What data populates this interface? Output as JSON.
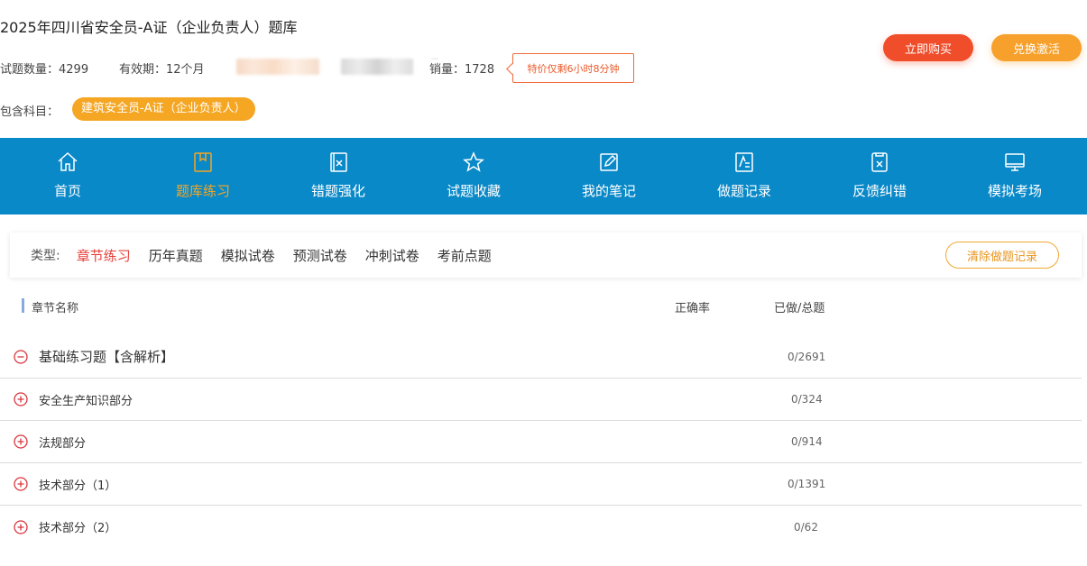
{
  "header": {
    "title": "2025年四川省安全员-A证（企业负责人）题库",
    "question_count": "试题数量：4299",
    "validity": "有效期：12个月",
    "sales": "销量：1728",
    "promo": "特价仅剩6小时8分钟",
    "subject_label": "包含科目：",
    "subject": "建筑安全员-A证（企业负责人）",
    "buy_label": "立即购买",
    "redeem_label": "兑换激活"
  },
  "nav": {
    "items": [
      {
        "label": "首页",
        "icon": "home-icon"
      },
      {
        "label": "题库练习",
        "icon": "book-icon"
      },
      {
        "label": "错题强化",
        "icon": "wrong-doc-icon"
      },
      {
        "label": "试题收藏",
        "icon": "star-icon"
      },
      {
        "label": "我的笔记",
        "icon": "edit-icon"
      },
      {
        "label": "做题记录",
        "icon": "record-icon"
      },
      {
        "label": "反馈纠错",
        "icon": "feedback-icon"
      },
      {
        "label": "模拟考场",
        "icon": "monitor-icon"
      }
    ],
    "active_index": 1
  },
  "filter": {
    "type_label": "类型:",
    "tabs": [
      "章节练习",
      "历年真题",
      "模拟试卷",
      "预测试卷",
      "冲刺试卷",
      "考前点题"
    ],
    "active_index": 0,
    "clear_label": "清除做题记录"
  },
  "table": {
    "headers": {
      "name": "章节名称",
      "accuracy": "正确率",
      "progress": "已做/总题"
    },
    "rows": [
      {
        "name": "基础练习题【含解析】",
        "progress": "0/2691",
        "expanded": true
      },
      {
        "name": "安全生产知识部分",
        "progress": "0/324",
        "expanded": false
      },
      {
        "name": "法规部分",
        "progress": "0/914",
        "expanded": false
      },
      {
        "name": "技术部分（1）",
        "progress": "0/1391",
        "expanded": false
      },
      {
        "name": "技术部分（2）",
        "progress": "0/62",
        "expanded": false
      }
    ]
  },
  "colors": {
    "nav_bg": "#0a89c8",
    "active": "#f5a623",
    "accent_red": "#e8403a",
    "buy": "#f04d2a",
    "redeem": "#f7a02b"
  }
}
